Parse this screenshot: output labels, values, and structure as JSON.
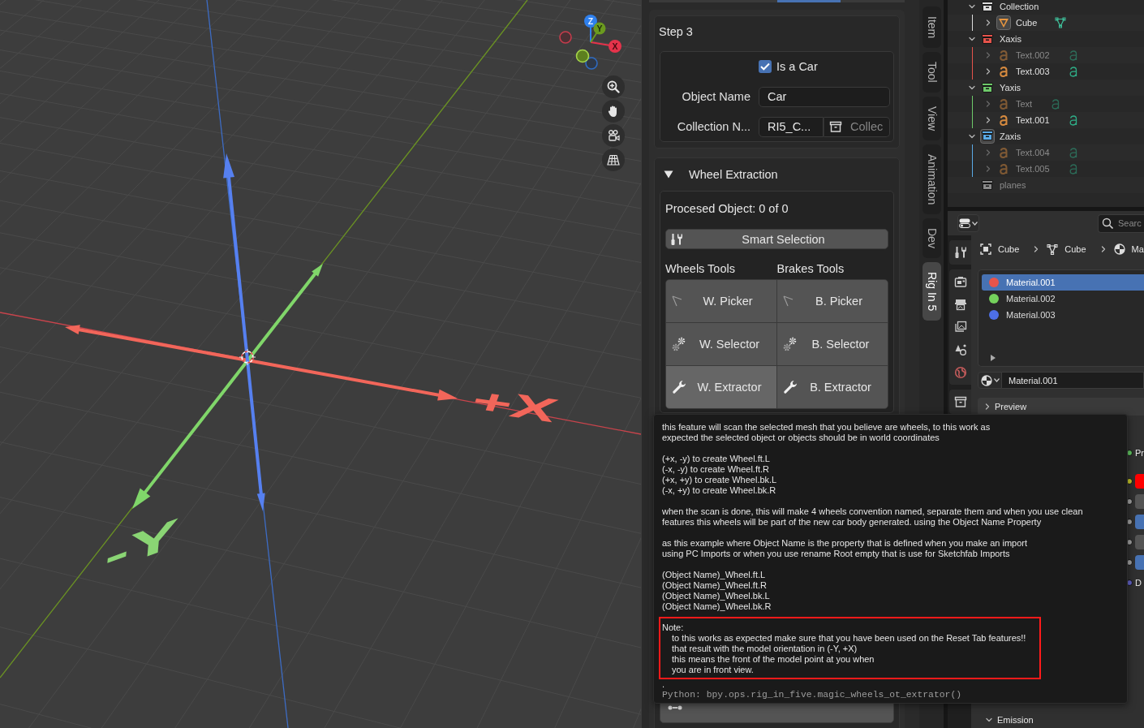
{
  "viewport": {
    "gizmo_axes": [
      "Z",
      "Y",
      "X"
    ],
    "scene_labels": [
      "+X",
      "-Y"
    ]
  },
  "sidebar": {
    "tabs": [
      {
        "label": "Item",
        "selected": false
      },
      {
        "label": "Tool",
        "selected": false
      },
      {
        "label": "View",
        "selected": false
      },
      {
        "label": "Animation",
        "selected": false
      },
      {
        "label": "Dev",
        "selected": false
      },
      {
        "label": "Rig In 5",
        "selected": true
      }
    ],
    "step_panel": {
      "title": "Step 3",
      "is_car": {
        "label": "Is a Car",
        "checked": true
      },
      "object_name": {
        "label": "Object Name",
        "value": "Car"
      },
      "collection_name": {
        "label": "Collection N...",
        "value": "RI5_C...",
        "placeholder": "Collec"
      }
    },
    "wheel_panel": {
      "title": "Wheel Extraction",
      "expanded": true,
      "status": "Procesed Object: 0 of 0",
      "smart_selection": "Smart Selection",
      "tool_columns": [
        {
          "heading": "Wheels Tools",
          "buttons": [
            {
              "label": "W. Picker",
              "kind": "picker",
              "highlighted": false
            },
            {
              "label": "W. Selector",
              "kind": "selector",
              "highlighted": false
            },
            {
              "label": "W. Extractor",
              "kind": "extractor",
              "highlighted": true
            }
          ]
        },
        {
          "heading": "Brakes Tools",
          "buttons": [
            {
              "label": "B. Picker",
              "kind": "picker",
              "highlighted": false
            },
            {
              "label": "B. Selector",
              "kind": "selector",
              "highlighted": false
            },
            {
              "label": "B. Extractor",
              "kind": "extractor",
              "highlighted": false
            }
          ]
        }
      ]
    }
  },
  "outliner": {
    "items": [
      {
        "kind": "collection",
        "name": "Collection",
        "color": "#dcdcdc",
        "expanded": true,
        "active": false,
        "hidden": false,
        "children": [
          {
            "kind": "mesh",
            "name": "Cube",
            "expanded": false,
            "active": true,
            "hidden": false
          }
        ]
      },
      {
        "kind": "collection",
        "name": "Xaxis",
        "color": "#e5534b",
        "expanded": true,
        "active": false,
        "hidden": false,
        "children": [
          {
            "kind": "text",
            "name": "Text.002",
            "expanded": false,
            "active": false,
            "hidden": true
          },
          {
            "kind": "text",
            "name": "Text.003",
            "expanded": false,
            "active": false,
            "hidden": false
          }
        ]
      },
      {
        "kind": "collection",
        "name": "Yaxis",
        "color": "#6ec96a",
        "expanded": true,
        "active": false,
        "hidden": false,
        "children": [
          {
            "kind": "text",
            "name": "Text",
            "expanded": false,
            "active": false,
            "hidden": true
          },
          {
            "kind": "text",
            "name": "Text.001",
            "expanded": false,
            "active": false,
            "hidden": false
          }
        ]
      },
      {
        "kind": "collection",
        "name": "Zaxis",
        "color": "#5aaae6",
        "expanded": true,
        "active": true,
        "hidden": false,
        "children": [
          {
            "kind": "text",
            "name": "Text.004",
            "expanded": false,
            "active": false,
            "hidden": true
          },
          {
            "kind": "text",
            "name": "Text.005",
            "expanded": false,
            "active": false,
            "hidden": true
          }
        ]
      },
      {
        "kind": "collection",
        "name": "planes",
        "color": "#8a8a8a",
        "active": false,
        "hidden": true
      }
    ]
  },
  "properties": {
    "search_placeholder": "Searc",
    "breadcrumb": [
      {
        "kind": "object",
        "label": "Cube"
      },
      {
        "kind": "mesh",
        "label": "Cube"
      },
      {
        "kind": "material",
        "label": "Ma"
      }
    ],
    "material_slots": [
      {
        "name": "Material.001",
        "color": "#e8544a",
        "selected": true
      },
      {
        "name": "Material.002",
        "color": "#74d15c",
        "selected": false
      },
      {
        "name": "Material.003",
        "color": "#4d6fe6",
        "selected": false
      }
    ],
    "material_field": "Material.001",
    "preview": {
      "title": "Preview",
      "expanded": false
    },
    "inputs": [
      {
        "kind": "shader",
        "text": "Pr"
      },
      {
        "kind": "color",
        "color": "#ff0000"
      },
      {
        "kind": "value"
      },
      {
        "kind": "factor"
      },
      {
        "kind": "value"
      },
      {
        "kind": "factor"
      },
      {
        "kind": "vector",
        "text": "D"
      }
    ],
    "emission": {
      "title": "Emission",
      "expanded": true
    }
  },
  "tooltip": {
    "paragraphs": [
      "this feature will scan the selected mesh that you believe are wheels, to this work as\nexpected the selected object or objects should be in world coordinates",
      "(+x, -y) to create Wheel.ft.L\n(-x, -y) to create Wheel.ft.R\n(+x, +y) to create Wheel.bk.L\n(-x, +y) to create Wheel.bk.R",
      "when the scan is done, this will make 4 wheels convention named, separate them and when you use clean\nfeatures this wheels will be part of the new car body generated. using the Object Name Property",
      "as this example where Object Name is the property that is defined when you make an import\nusing PC Imports or when you use rename Root empty that is use for Sketchfab Imports",
      "(Object Name)_Wheel.ft.L\n(Object Name)_Wheel.ft.R\n(Object Name)_Wheel.bk.L\n(Object Name)_Wheel.bk.R"
    ],
    "note": {
      "title": "Note:",
      "body": "to this works as expected make sure that you have been used on the Reset Tab features!!\nthat result with the model orientation in (-Y, +X)\nthis means the front of the model point at you when\nyou are in front view.",
      "framed": true
    },
    "trailer": ".",
    "python": "Python: bpy.ops.rig_in_five.magic_wheels_ot_extrator()"
  }
}
